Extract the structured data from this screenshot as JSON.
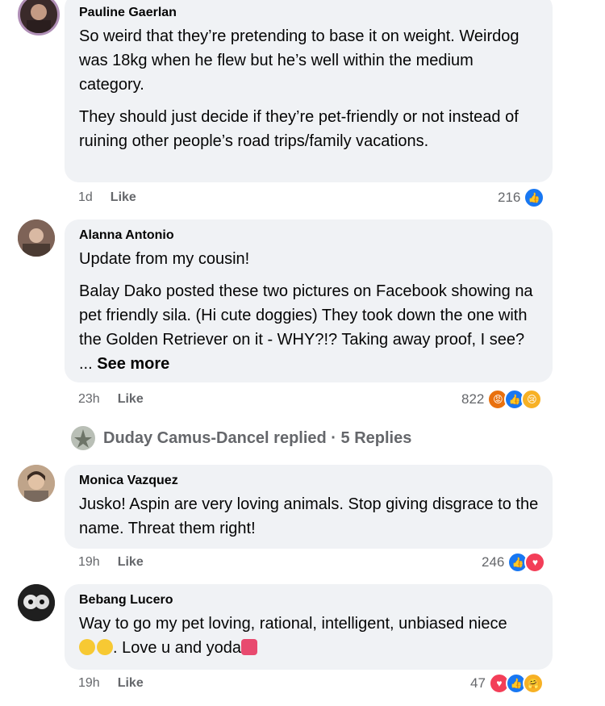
{
  "comments": [
    {
      "author": "Pauline Gaerlan",
      "paragraphs": [
        "So weird that they’re pretending to base it on weight. Weirdog was 18kg when he flew but he’s well within the medium category.",
        "They should just decide if they’re pet-friendly or not instead of ruining other people’s road trips/family vacations."
      ],
      "time": "1d",
      "like_label": "Like",
      "reaction_count": "216",
      "reaction_icons": [
        "like-icon"
      ]
    },
    {
      "author": "Alanna Antonio",
      "paragraphs": [
        "Update from my cousin!",
        "Balay Dako posted these two pictures on Facebook showing na pet friendly sila. (Hi cute doggies) They took down the one with the Golden Retriever on it - WHY?!? Taking away proof, I see? ..."
      ],
      "see_more": "See more",
      "time": "23h",
      "like_label": "Like",
      "reaction_count": "822",
      "reaction_icons": [
        "angry-icon",
        "like-icon",
        "sad-icon"
      ]
    },
    {
      "author": "Monica Vazquez",
      "paragraphs": [
        "Jusko! Aspin are very loving animals. Stop giving disgrace to the name. Threat them right!"
      ],
      "time": "19h",
      "like_label": "Like",
      "reaction_count": "246",
      "reaction_icons": [
        "like-icon",
        "love-icon"
      ]
    },
    {
      "author": "Bebang Lucero",
      "paragraphs": [
        "Way to go my pet loving, rational, intelligent, unbiased niece",
        ". Love u and yoda"
      ],
      "time": "19h",
      "like_label": "Like",
      "reaction_count": "47",
      "reaction_icons": [
        "love-icon",
        "like-icon",
        "care-icon"
      ]
    }
  ],
  "replied": {
    "text": "Duday Camus-Dancel replied · 5 Replies"
  },
  "colors": {
    "bubble": "#f0f2f5",
    "meta_text": "#65676b",
    "like_blue": "#1877f2",
    "love_red": "#f33e58",
    "angry_orange": "#e9710f"
  }
}
